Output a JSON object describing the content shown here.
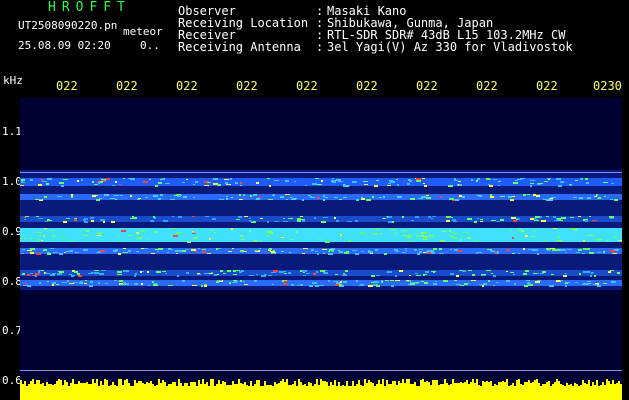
{
  "header": {
    "title": "HROFFT",
    "file_name": "UT2508090220.pn",
    "meteor_label": "meteor",
    "date_time": "25.08.09 02:20",
    "count": "0.."
  },
  "station": {
    "rows": [
      {
        "label": "Observer",
        "value": "Masaki Kano"
      },
      {
        "label": "Receiving Location",
        "value": "Shibukawa, Gunma, Japan"
      },
      {
        "label": "Receiver",
        "value": "RTL-SDR SDR# 43dB L15 103.2MHz CW"
      },
      {
        "label": "Receiving Antenna",
        "value": "3el Yagi(V) Az 330 for Vladivostok"
      }
    ]
  },
  "axes": {
    "y_unit": "kHz",
    "y_ticks": [
      "1.1",
      "1.0",
      "0.9",
      "0.8",
      "0.7",
      "0.6"
    ],
    "time_ticks": [
      "022",
      "022",
      "022",
      "022",
      "022",
      "022",
      "022",
      "022",
      "022",
      "0230"
    ]
  },
  "colors": {
    "background": "#000000",
    "plot_background": "#000033",
    "title": "#22ff44",
    "time_ticks": "#ffff66",
    "noise_floor": "#ffff00"
  }
}
